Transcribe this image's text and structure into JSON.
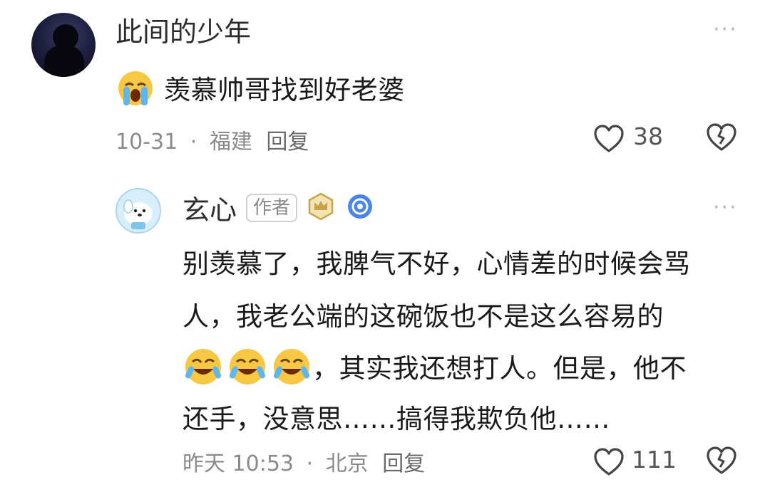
{
  "comment": {
    "username": "此间的少年",
    "text": "羡慕帅哥找到好老婆",
    "date": "10-31",
    "separator": "·",
    "location": "福建",
    "reply_label": "回复",
    "like_count": "38",
    "more_label": "···"
  },
  "reply": {
    "username": "玄心",
    "author_badge": "作者",
    "lines": [
      "别羡慕了，我脾气不好，心情差的时候会骂",
      "人，我老公端的这碗饭也不是这么容易的",
      "，其实我还想打人。但是，他不",
      "还手，没意思……搞得我欺负他……"
    ],
    "time": "昨天 10:53",
    "separator": "·",
    "location": "北京",
    "reply_label": "回复",
    "like_count": "111",
    "more_label": "···"
  },
  "icons": {
    "crying_emoji": "loudly-crying-face-icon",
    "laughing_crying_emoji": "rolling-laughing-icon",
    "heart": "heart-outline-icon",
    "dislike": "broken-heart-icon",
    "crown_badge": "crown-badge-icon",
    "verified_badge": "blue-circle-badge-icon"
  },
  "colors": {
    "crown_gold": "#c9a24a",
    "badge_blue": "#4a86e8",
    "emoji_yellow": "#f7c843",
    "tear_blue": "#5fb5ee"
  }
}
